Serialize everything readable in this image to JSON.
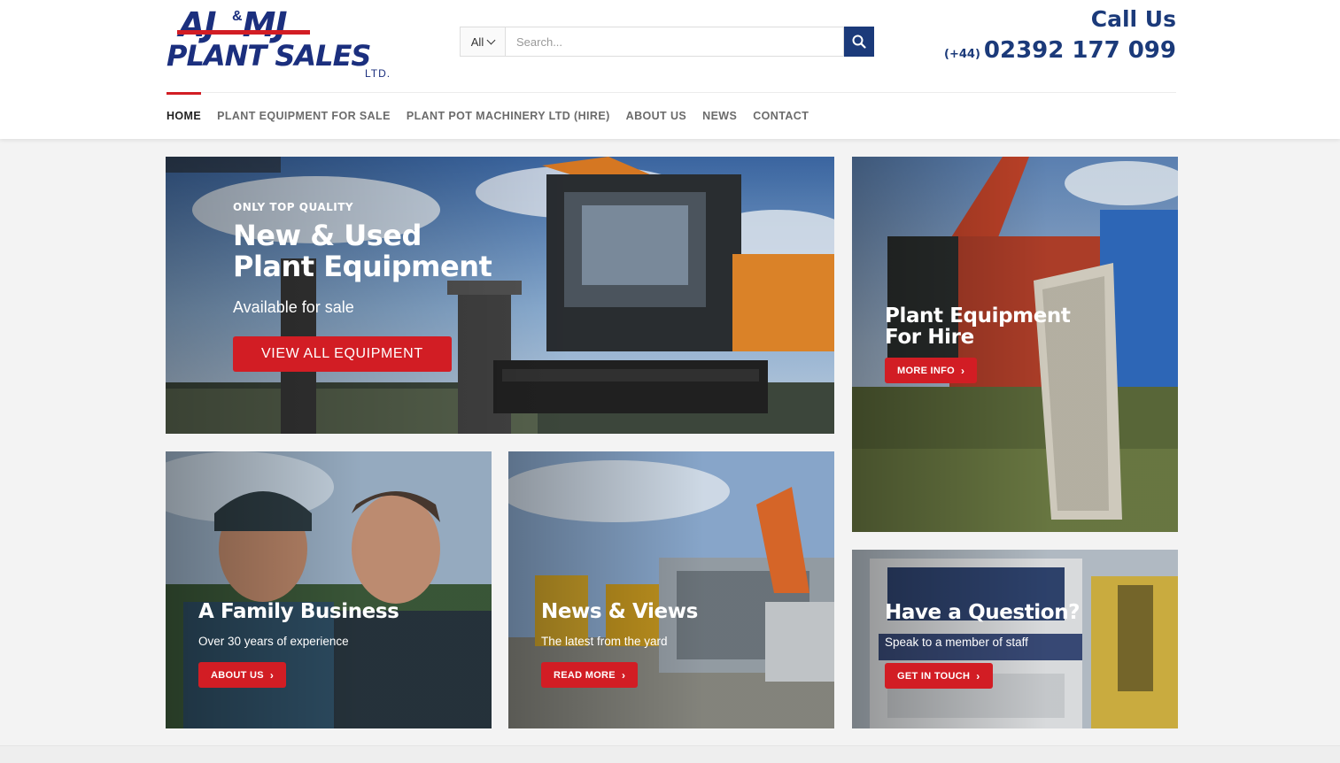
{
  "brand": {
    "logo_line1": "AJ",
    "logo_amp": "&",
    "logo_line1b": "MJ",
    "logo_line2": "PLANT SALES",
    "logo_line3": "LTD."
  },
  "search": {
    "category": "All",
    "placeholder": "Search..."
  },
  "contact": {
    "label": "Call Us",
    "prefix": "(+44)",
    "phone": "02392 177 099"
  },
  "nav": {
    "items": [
      {
        "label": "HOME"
      },
      {
        "label": "PLANT EQUIPMENT FOR SALE"
      },
      {
        "label": "PLANT POT MACHINERY LTD (HIRE)"
      },
      {
        "label": "ABOUT US"
      },
      {
        "label": "NEWS"
      },
      {
        "label": "CONTACT"
      }
    ]
  },
  "hero": {
    "kicker": "ONLY TOP QUALITY",
    "title_line1": "New & Used",
    "title_line2": "Plant Equipment",
    "subtitle": "Available for sale",
    "button": "VIEW ALL EQUIPMENT"
  },
  "hire": {
    "title_line1": "Plant Equipment",
    "title_line2": "For Hire",
    "button": "MORE INFO"
  },
  "family": {
    "title": "A Family Business",
    "subtitle": "Over 30 years of experience",
    "button": "ABOUT US"
  },
  "news": {
    "title": "News & Views",
    "subtitle": "The latest from the yard",
    "button": "READ MORE"
  },
  "question": {
    "title": "Have a Question?",
    "subtitle": "Speak to a member of staff",
    "button": "GET IN TOUCH"
  },
  "colors": {
    "brand_blue": "#1b3a7a",
    "accent_red": "#d21d24"
  }
}
